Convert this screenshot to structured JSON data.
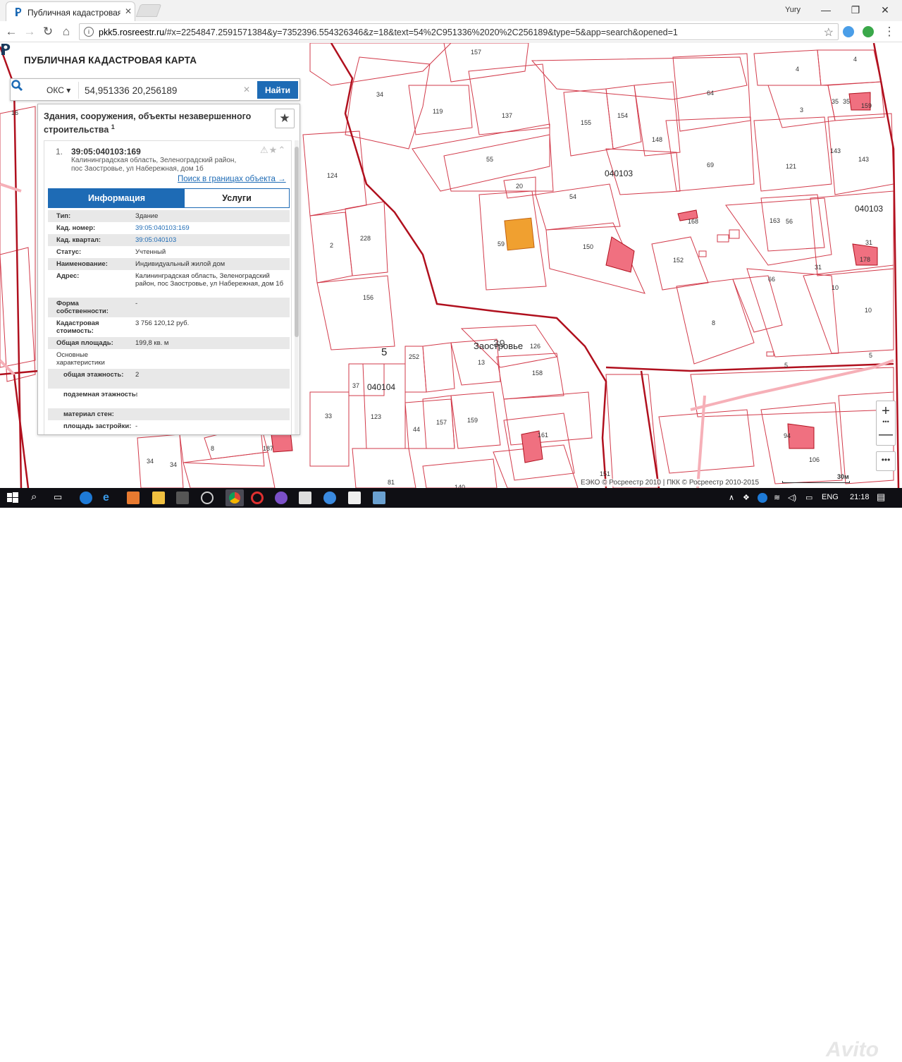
{
  "browser": {
    "tab_title": "Публичная кадастровая",
    "user": "Yury",
    "url_host": "pkk5.rosreestr.ru",
    "url_rest": "/#x=2254847.2591571384&y=7352396.554326346&z=18&text=54%2C951336%2020%2C256189&type=5&app=search&opened=1"
  },
  "app": {
    "title": "ПУБЛИЧНАЯ КАДАСТРОВАЯ КАРТА",
    "search": {
      "type_label": "ОКС",
      "query": "54,951336 20,256189",
      "button": "Найти"
    },
    "panel": {
      "title": "Здания, сооружения, объекты незавершенного строительства",
      "title_sup": "1",
      "record": {
        "index": "1.",
        "id": "39:05:040103:169",
        "address": "Калининградская область, Зеленоградский район, пос Заостровье, ул Набережная, дом 1б",
        "link": "Поиск в границах объекта →"
      },
      "tabs": {
        "info": "Информация",
        "services": "Услуги"
      },
      "props": [
        {
          "k": "Тип:",
          "v": "Здание"
        },
        {
          "k": "Кад. номер:",
          "v": "39:05:040103:169"
        },
        {
          "k": "Кад. квартал:",
          "v": "39:05:040103"
        },
        {
          "k": "Статус:",
          "v": "Учтенный"
        },
        {
          "k": "Наименование:",
          "v": "Индивидуальный жилой дом"
        },
        {
          "k": "Адрес:",
          "v": "Калининградская область, Зеленоградский район, пос Заостровье, ул Набережная, дом 1б"
        },
        {
          "k": "Форма собственности:",
          "v": "-"
        },
        {
          "k": "Кадастровая стоимость:",
          "v": "3 756 120,12 руб."
        },
        {
          "k": "Общая площадь:",
          "v": "199,8 кв. м"
        },
        {
          "k": "Основные характеристики",
          "v": ""
        },
        {
          "k": "общая этажность:",
          "v": "2"
        },
        {
          "k": "подземная этажность:",
          "v": "-"
        },
        {
          "k": "материал стен:",
          "v": ""
        },
        {
          "k": "площадь застройки:",
          "v": "-"
        }
      ]
    },
    "map": {
      "copyright": "ЕЭКО © Росреестр 2010 | ПКК © Росреестр 2010-2015",
      "scale": "30м",
      "labels": {
        "l157": "157",
        "l34": "34",
        "l16": "16",
        "l119": "119",
        "l137": "137",
        "l55": "55",
        "l64": "64",
        "l4a": "4",
        "l4b": "4",
        "l3": "3",
        "l35a": "35",
        "l35b": "35",
        "l159a": "159",
        "l155": "155",
        "l154": "154",
        "l148": "148",
        "l69": "69",
        "l121": "121",
        "l143a": "143",
        "l143b": "143",
        "l040103a": "040103",
        "l040103b": "040103",
        "l124": "124",
        "l20": "20",
        "l54": "54",
        "l168": "168",
        "l163": "163",
        "l56": "56",
        "l31a": "31",
        "l31b": "31",
        "l178": "178",
        "l2": "2",
        "l228": "228",
        "l59": "59",
        "l150": "150",
        "l152": "152",
        "l66": "66",
        "l10a": "10",
        "l10b": "10",
        "l156": "156",
        "l8a": "8",
        "l5a": "5",
        "l5b": "5",
        "l5c": "5",
        "l252": "252",
        "l13": "13",
        "l126": "126",
        "l158": "158",
        "l37": "37",
        "l040104": "040104",
        "l33": "33",
        "l123": "123",
        "l44": "44",
        "l157b": "157",
        "l159b": "159",
        "l161": "161",
        "l94": "94",
        "l106": "106",
        "l34b": "34",
        "l34c": "34",
        "l8b": "8",
        "l187": "187",
        "l151": "151",
        "l81": "81",
        "l140": "140",
        "l39": "39",
        "zaostrovye": "Заостровье"
      }
    }
  },
  "taskbar": {
    "lang": "ENG",
    "time": "21:18"
  },
  "colors": {
    "parcel": "#d23a4a",
    "quarter": "#b0101e",
    "selected": "#f0a030",
    "building": "#f07080",
    "accent": "#1e6bb5"
  }
}
